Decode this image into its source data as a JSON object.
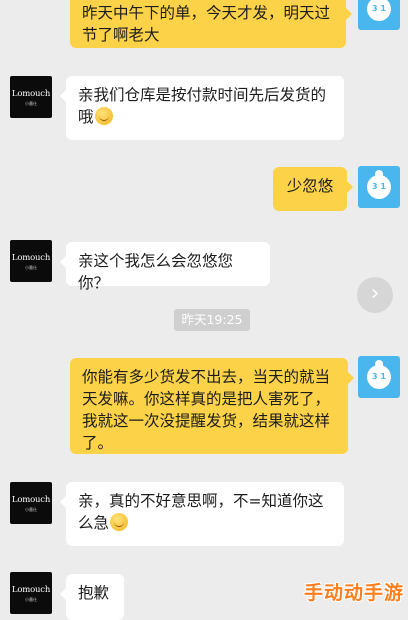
{
  "shop": {
    "brand": "Lomouch",
    "sub": "小墨仕"
  },
  "user": {
    "avatar_text": "3 1"
  },
  "messages": [
    {
      "side": "right",
      "text": "昨天中午下的单，今天才发，明天过节了啊老大"
    },
    {
      "side": "left",
      "text": "亲我们仓库是按付款时间先后发货的哦"
    },
    {
      "side": "right",
      "text": "少忽悠"
    },
    {
      "side": "left",
      "text": "亲这个我怎么会忽悠您你？"
    },
    {
      "side": "right",
      "text": "你能有多少货发不出去，当天的就当天发嘛。你这样真的是把人害死了，我就这一次没提醒发货，结果就这样了。"
    },
    {
      "side": "left",
      "text": "亲，真的不好意思啊，不=知道你这么急"
    },
    {
      "side": "left",
      "text": "抱歉"
    }
  ],
  "timestamp": "昨天19:25",
  "next_glyph": "›",
  "watermark": "手动动手游",
  "colors": {
    "background": "#ececec",
    "user_bubble": "#fcd249",
    "shop_bubble": "#ffffff",
    "user_avatar": "#4ab6ee"
  }
}
